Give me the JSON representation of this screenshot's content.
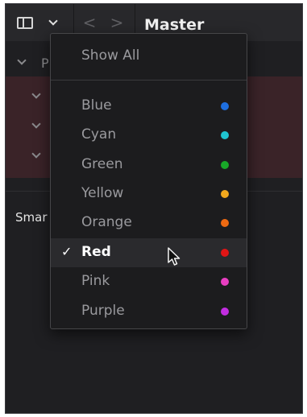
{
  "header": {
    "title": "Master",
    "back_glyph": "<",
    "forward_glyph": ">"
  },
  "background": {
    "row_label": "P",
    "smart_label": "Smar"
  },
  "dropdown": {
    "show_all": "Show All",
    "items": [
      {
        "label": "Blue",
        "color": "#1e6fe0"
      },
      {
        "label": "Cyan",
        "color": "#1fc4d0"
      },
      {
        "label": "Green",
        "color": "#18a728"
      },
      {
        "label": "Yellow",
        "color": "#f2a81d"
      },
      {
        "label": "Orange",
        "color": "#ee6a12"
      },
      {
        "label": "Red",
        "color": "#e01515"
      },
      {
        "label": "Pink",
        "color": "#e83ec1"
      },
      {
        "label": "Purple",
        "color": "#c22de0"
      }
    ],
    "selected": "Red",
    "check_glyph": "✓"
  },
  "icons": [
    "sidebar-toggle-icon",
    "chevron-down-icon",
    "back-arrow-icon",
    "forward-arrow-icon",
    "checkmark-icon",
    "mouse-cursor-icon",
    "color-dot-icon"
  ]
}
